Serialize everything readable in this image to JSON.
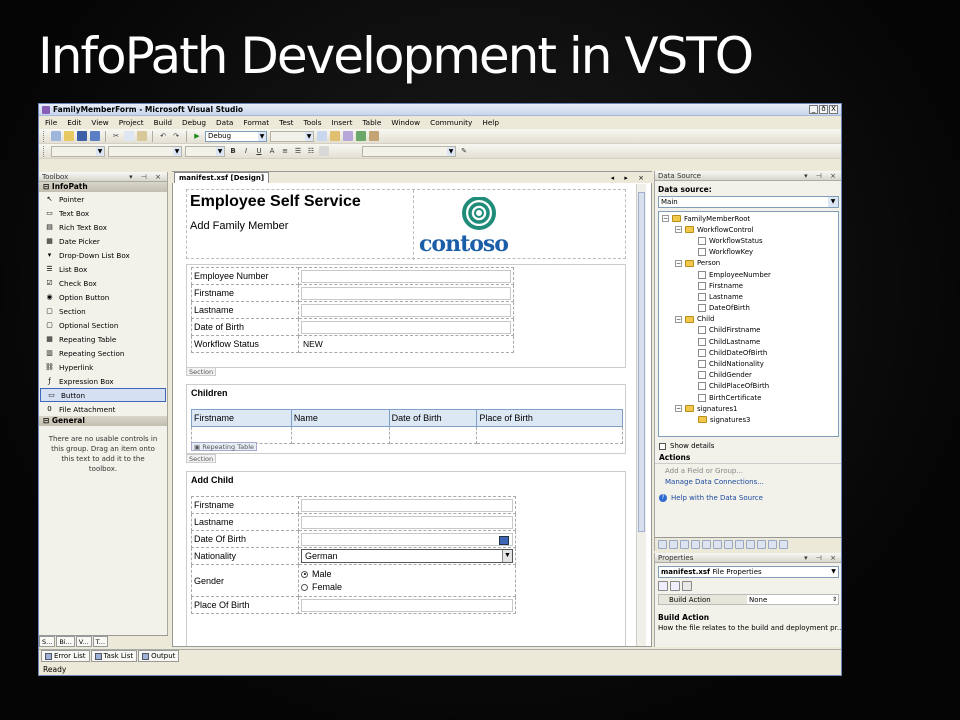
{
  "slide": {
    "title": "InfoPath Development in VSTO"
  },
  "window": {
    "title": "FamilyMemberForm - Microsoft Visual Studio",
    "buttons": [
      "_",
      "ð",
      "X"
    ]
  },
  "menu": [
    "File",
    "Edit",
    "View",
    "Project",
    "Build",
    "Debug",
    "Data",
    "Format",
    "Test",
    "Tools",
    "Insert",
    "Table",
    "Window",
    "Community",
    "Help"
  ],
  "toolbar": {
    "config": "Debug"
  },
  "toolbox": {
    "title": "Toolbox",
    "section_infopath": "InfoPath",
    "items": [
      "Pointer",
      "Text Box",
      "Rich Text Box",
      "Date Picker",
      "Drop-Down List Box",
      "List Box",
      "Check Box",
      "Option Button",
      "Section",
      "Optional Section",
      "Repeating Table",
      "Repeating Section",
      "Hyperlink",
      "Expression Box",
      "Button",
      "File Attachment"
    ],
    "section_general": "General",
    "general_note": "There are no usable controls in this group. Drag an item onto this text to add it to the toolbox.",
    "bottom_tabs": [
      "S...",
      "Bi...",
      "V...",
      "T..."
    ]
  },
  "document": {
    "tab": "manifest.xsf [Design]",
    "header_title": "Employee Self Service",
    "header_subtitle": "Add Family Member",
    "logo_text": "contoso",
    "employee_fields": [
      "Employee Number",
      "Firstname",
      "Lastname",
      "Date of Birth",
      "Workflow Status"
    ],
    "workflow_status_value": "NEW",
    "section_tag": "Section",
    "children_title": "Children",
    "children_columns": [
      "Firstname",
      "Name",
      "Date of Birth",
      "Place of Birth"
    ],
    "repeating_table_tag": "Repeating Table",
    "add_child_title": "Add Child",
    "add_child_fields": [
      "Firstname",
      "Lastname",
      "Date Of Birth",
      "Nationality",
      "Gender",
      "Place Of Birth"
    ],
    "nationality_value": "German",
    "gender_options": [
      "Male",
      "Female"
    ]
  },
  "data_source": {
    "title": "Data Source",
    "label": "Data source:",
    "selected": "Main",
    "tree": [
      {
        "label": "FamilyMemberRoot",
        "level": 0,
        "type": "folder",
        "exp": "−"
      },
      {
        "label": "WorkflowControl",
        "level": 1,
        "type": "folder",
        "exp": "−"
      },
      {
        "label": "WorkflowStatus",
        "level": 2,
        "type": "leaf"
      },
      {
        "label": "WorkflowKey",
        "level": 2,
        "type": "leaf"
      },
      {
        "label": "Person",
        "level": 1,
        "type": "folder",
        "exp": "−"
      },
      {
        "label": "EmployeeNumber",
        "level": 2,
        "type": "leaf"
      },
      {
        "label": "Firstname",
        "level": 2,
        "type": "leaf"
      },
      {
        "label": "Lastname",
        "level": 2,
        "type": "leaf"
      },
      {
        "label": "DateOfBirth",
        "level": 2,
        "type": "leaf"
      },
      {
        "label": "Child",
        "level": 1,
        "type": "folder",
        "exp": "−"
      },
      {
        "label": "ChildFirstname",
        "level": 2,
        "type": "leaf"
      },
      {
        "label": "ChildLastname",
        "level": 2,
        "type": "leaf"
      },
      {
        "label": "ChildDateOfBirth",
        "level": 2,
        "type": "leaf"
      },
      {
        "label": "ChildNationality",
        "level": 2,
        "type": "leaf"
      },
      {
        "label": "ChildGender",
        "level": 2,
        "type": "leaf"
      },
      {
        "label": "ChildPlaceOfBirth",
        "level": 2,
        "type": "leaf"
      },
      {
        "label": "BirthCertificate",
        "level": 2,
        "type": "leaf"
      },
      {
        "label": "signatures1",
        "level": 1,
        "type": "folder",
        "exp": "−"
      },
      {
        "label": "signatures3",
        "level": 2,
        "type": "folder"
      }
    ],
    "show_details": "Show details",
    "actions_title": "Actions",
    "action_add": "Add a Field or Group...",
    "action_manage": "Manage Data Connections...",
    "help": "Help with the Data Source"
  },
  "properties": {
    "title": "Properties",
    "object": "manifest.xsf",
    "object_type": "File Properties",
    "row_key": "Build Action",
    "row_value": "None",
    "desc_title": "Build Action",
    "desc": "How the file relates to the build and deployment pr..."
  },
  "output_tabs": [
    "Error List",
    "Task List",
    "Output"
  ],
  "status": "Ready"
}
